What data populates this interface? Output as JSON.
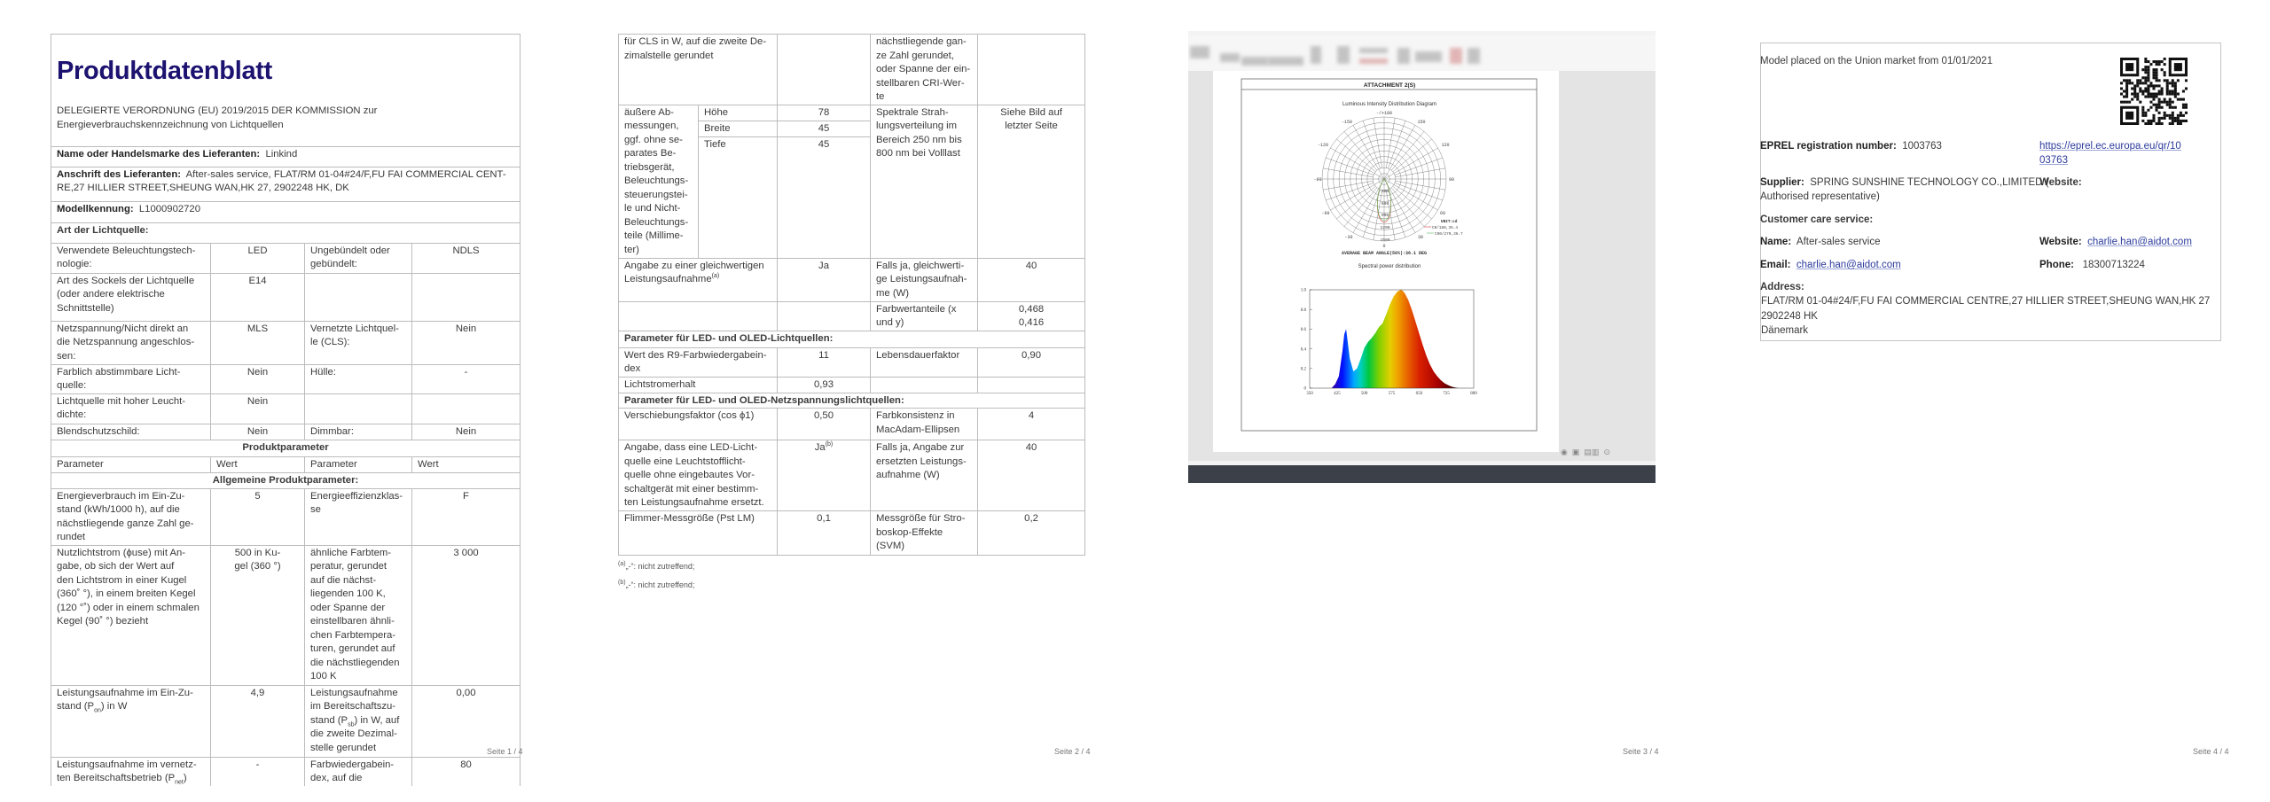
{
  "page1": {
    "title": "Produktdatenblatt",
    "subtitle": "DELEGIERTE VERORDNUNG (EU) 2019/2015 DER KOMMISSION zur\nEnergieverbrauchskennzeichnung von Lichtquellen",
    "supplier_label": "Name oder Handelsmarke des Lieferanten:",
    "supplier_value": "Linkind",
    "address_label": "Anschrift des Lieferanten:",
    "address_value": "After-sales service, FLAT/RM 01-04#24/F,FU FAI COMMERCIAL CENT-\nRE,27 HILLIER STREET,SHEUNG WAN,HK 27, 2902248 HK, DK",
    "model_label": "Modellkennung:",
    "model_value": "L1000902720",
    "type_heading": "Art der Lichtquelle:",
    "rows": [
      [
        "Verwendete Beleuchtungstech-\nnologie:",
        "LED",
        "Ungebündelt oder\ngebündelt:",
        "NDLS"
      ],
      [
        "Art des Sockels der Lichtquelle\n(oder andere elektrische\nSchnittstelle)",
        "E14",
        "",
        ""
      ],
      [
        "Netzspannung/Nicht direkt an\ndie Netzspannung angeschlos-\nsen:",
        "MLS",
        "Vernetzte Lichtquel-\nle (CLS):",
        "Nein"
      ],
      [
        "Farblich abstimmbare Licht-\nquelle:",
        "Nein",
        "Hülle:",
        "-"
      ],
      [
        "Lichtquelle mit hoher Leucht-\ndichte:",
        "Nein",
        "",
        ""
      ],
      [
        "Blendschutzschild:",
        "Nein",
        "Dimmbar:",
        "Nein"
      ]
    ],
    "params_heading": "Produktparameter",
    "params_header": [
      "Parameter",
      "Wert",
      "Parameter",
      "Wert"
    ],
    "general_heading": "Allgemeine Produktparameter:",
    "energy": [
      "Energieverbrauch im Ein-Zu-\nstand (kWh/1000 h), auf die\nnächstliegende ganze Zahl ge-\nrundet",
      "5",
      "Energieeffizienzklas-\nse",
      "F"
    ],
    "flux": [
      "Nutzlichtstrom (ϕuse) mit An-\ngabe, ob sich der Wert auf\nden Lichtstrom in einer Kugel\n(360˚ °), in einem breiten Kegel\n(120 °˚) oder in einem schmalen\nKegel (90˚ °) bezieht",
      "500 in Ku-\ngel (360 °)",
      "ähnliche Farbtem-\nperatur, gerundet\nauf die nächst-\nliegenden 100 K,\noder Spanne der\neinstellbaren ähnli-\nchen Farbtempera-\nturen, gerundet auf\ndie nächstliegenden\n100 K",
      "3 000"
    ],
    "pon": {
      "pre": "Leistungsaufnahme im Ein-Zu-\nstand (P",
      "sub": "on",
      "post": ") in W",
      "value": "4,9"
    },
    "psb": {
      "pre": "Leistungsaufnahme\nim Bereitschaftszu-\nstand (P",
      "sub": "sb",
      "post": ") in W, auf\ndie zweite Dezimal-\nstelle gerundet",
      "value": "0,00"
    },
    "pnet": {
      "pre": "Leistungsaufnahme im vernetz-\nten Bereitschaftsbetrieb (P",
      "sub": "net",
      "post": ")",
      "value": "-"
    },
    "cri": {
      "label": "Farbwiedergabein-\ndex, auf die",
      "value": "80"
    },
    "footer": "Seite 1 / 4"
  },
  "page2": {
    "cls_cont": "für CLS in W, auf die zweite De-\nzimalstelle gerundet",
    "cri_cont": "nächstliegende gan-\nze Zahl gerundet,\noder Spanne der ein-\nstellbaren CRI-Wer-\nte",
    "dims_label": "äußere Ab-\nmessungen,\nggf. ohne se-\nparates Be-\ntriebsgerät,\nBeleuchtungs-\nsteuerungstei-\nle und Nicht-\nBeleuchtungs-\nteile (Millime-\nter)",
    "dims": [
      {
        "label": "Höhe",
        "value": "78"
      },
      {
        "label": "Breite",
        "value": "45"
      },
      {
        "label": "Tiefe",
        "value": "45"
      }
    ],
    "spectral_label": "Spektrale Strah-\nlungsverteilung im\nBereich 250 nm bis\n800 nm bei Volllast",
    "spectral_value": "Siehe Bild auf\nletzter Seite",
    "equiv": {
      "pre": "Angabe zu einer gleichwertigen\nLeistungsaufnahme",
      "sup": "(a)",
      "value": "Ja",
      "label2": "Falls ja, gleichwerti-\nge Leistungsaufnah-\nme (W)",
      "value2": "40"
    },
    "chroma": {
      "label": "Farbwertanteile (x\nund y)",
      "value": "0,468\n0,416"
    },
    "led_heading": "Parameter für LED- und OLED-Lichtquellen:",
    "r9": {
      "label": "Wert des R9-Farbwiedergabein-\ndex",
      "value": "11",
      "label2": "Lebensdauerfaktor",
      "value2": "0,90"
    },
    "maint": {
      "label": "Lichtstromerhalt",
      "value": "0,93"
    },
    "mains_heading": "Parameter für LED- und OLED-Netzspannungslichtquellen:",
    "disp": {
      "label": "Verschiebungsfaktor (cos ϕ1)",
      "value": "0,50",
      "label2": "Farbkonsistenz in\nMacAdam-Ellipsen",
      "value2": "4"
    },
    "replace": {
      "label": "Angabe, dass eine LED-Licht-\nquelle eine Leuchtstofflicht-\nquelle ohne eingebautes Vor-\nschaltgerät mit einer bestimm-\nten Leistungsaufnahme ersetzt.",
      "value": "Ja",
      "sup": "(b)",
      "label2": "Falls ja, Angabe zur\nersetzten Leistungs-\naufnahme (W)",
      "value2": "40"
    },
    "flicker": {
      "label": "Flimmer-Messgröße (Pst LM)",
      "value": "0,1",
      "label2": "Messgröße für Stro-\nboskop-Effekte\n(SVM)",
      "value2": "0,2"
    },
    "footnotes": [
      {
        "mark": "(a)",
        "text": "„-“: nicht zutreffend;"
      },
      {
        "mark": "(b)",
        "text": "„-“: nicht zutreffend;"
      }
    ],
    "footer": "Seite 2 / 4"
  },
  "page3": {
    "attachment_title": "ATTACHMENT 2(S)",
    "polar_title": "Luminous Intensity Distribution Diagram",
    "angle_labels": [
      "-/+180",
      "-150",
      "150",
      "-120",
      "120",
      "-90",
      "90",
      "-60",
      "60",
      "-30",
      "30",
      "0"
    ],
    "ring_labels": [
      "300",
      "600",
      "900",
      "1200",
      "1500"
    ],
    "unit": "UNIT:cd",
    "legend": [
      "C0/180,35.4",
      "C90/270,36.7"
    ],
    "beam_angle": "AVERAGE BEAM ANGLE(50%):36.1 DEG",
    "spectral_title": "Spectral power distribution",
    "footer": "Seite 3 / 4"
  },
  "chart_data": [
    {
      "type": "polar",
      "title": "Luminous Intensity Distribution Diagram",
      "unit": "cd",
      "radial_ticks": [
        300,
        600,
        900,
        1200,
        1500
      ],
      "angle_ticks": [
        -180,
        -150,
        -120,
        -90,
        -60,
        -30,
        0,
        30,
        60,
        90,
        120,
        150,
        180
      ],
      "series": [
        {
          "name": "C0/180,35.4",
          "color": "#d04040",
          "peak_cd": 1150,
          "beam_angle_deg": 35.4
        },
        {
          "name": "C90/270,36.7",
          "color": "#5cb85c",
          "peak_cd": 1100,
          "beam_angle_deg": 36.7
        }
      ]
    },
    {
      "type": "area",
      "title": "Spectral power distribution",
      "xlabel": "",
      "ylabel": "",
      "xlim": [
        350,
        800
      ],
      "ylim": [
        0,
        1.0
      ],
      "xticks": [
        350,
        425,
        500,
        575,
        650,
        725,
        800
      ],
      "yticks": [
        "0",
        "0.2",
        "0.4",
        "0.6",
        "0.8",
        "1.0"
      ],
      "x": [
        350,
        410,
        420,
        430,
        440,
        445,
        450,
        455,
        460,
        470,
        480,
        490,
        500,
        510,
        520,
        530,
        540,
        550,
        560,
        570,
        580,
        590,
        600,
        605,
        610,
        620,
        630,
        640,
        650,
        660,
        670,
        680,
        690,
        700,
        710,
        720,
        730,
        740,
        750,
        760,
        800
      ],
      "values": [
        0,
        0,
        0.04,
        0.12,
        0.38,
        0.55,
        0.6,
        0.45,
        0.3,
        0.17,
        0.2,
        0.3,
        0.41,
        0.47,
        0.51,
        0.56,
        0.62,
        0.66,
        0.75,
        0.85,
        0.93,
        0.98,
        1.0,
        0.99,
        0.97,
        0.9,
        0.8,
        0.68,
        0.56,
        0.44,
        0.33,
        0.24,
        0.17,
        0.12,
        0.08,
        0.05,
        0.03,
        0.015,
        0.006,
        0,
        0
      ]
    }
  ],
  "page4": {
    "placed": "Model placed on the Union market from 01/01/2021",
    "eprel_label": "EPREL registration number:",
    "eprel_value": "1003763",
    "eprel_link_1": "https://eprel.ec.europa.eu/qr/10",
    "eprel_link_2": "03763",
    "supplier_label": "Supplier:",
    "supplier_value_1": "SPRING SUNSHINE TECHNOLOGY CO.,LIMITED (",
    "supplier_value_2": "Authorised representative)",
    "website_label": "Website:",
    "care_heading": "Customer care service:",
    "name_label": "Name:",
    "name_value": "After-sales service",
    "website2_label": "Website:",
    "website2_value": "charlie.han@aidot.com",
    "email_label": "Email:",
    "email_value": "charlie.han@aidot.com",
    "phone_label": "Phone:",
    "phone_value": "18300713224",
    "address_label": "Address:",
    "address_lines": [
      "FLAT/RM 01-04#24/F,FU FAI COMMERCIAL CENTRE,27 HILLIER STREET,SHEUNG WAN,HK 27",
      "2902248 HK",
      "Dänemark"
    ],
    "footer": "Seite 4 / 4"
  }
}
